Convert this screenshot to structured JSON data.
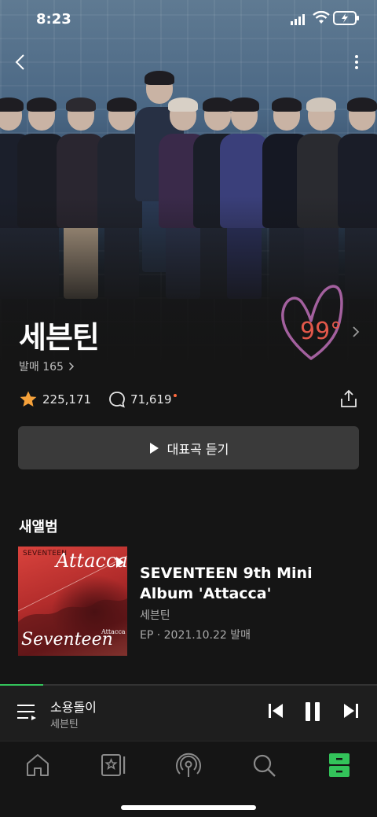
{
  "status_bar": {
    "time": "8:23"
  },
  "artist": {
    "name": "세븐틴",
    "releases_label": "발매 165",
    "temperature": "99°",
    "likes": "225,171",
    "comments": "71,619"
  },
  "actions": {
    "play_top_label": "대표곡 듣기"
  },
  "new_album": {
    "section_title": "새앨범",
    "title": "SEVENTEEN 9th Mini Album 'Attacca'",
    "artist": "세븐틴",
    "meta": "EP · 2021.10.22 발매",
    "cover": {
      "brand": "SEVENTEEN",
      "big_word": "Attacca",
      "script": "Seventeen",
      "small": "Attacca"
    }
  },
  "now_playing": {
    "title": "소용돌이",
    "artist": "세븐틴",
    "progress": 0.115
  },
  "colors": {
    "accent_green": "#33c35a",
    "temp_red": "#e2584a",
    "star_orange": "#f5a13a"
  },
  "tabs": [
    {
      "icon": "home-icon"
    },
    {
      "icon": "library-card-icon"
    },
    {
      "icon": "podcast-icon"
    },
    {
      "icon": "search-icon"
    },
    {
      "icon": "my-drawer-icon",
      "active": true
    }
  ]
}
